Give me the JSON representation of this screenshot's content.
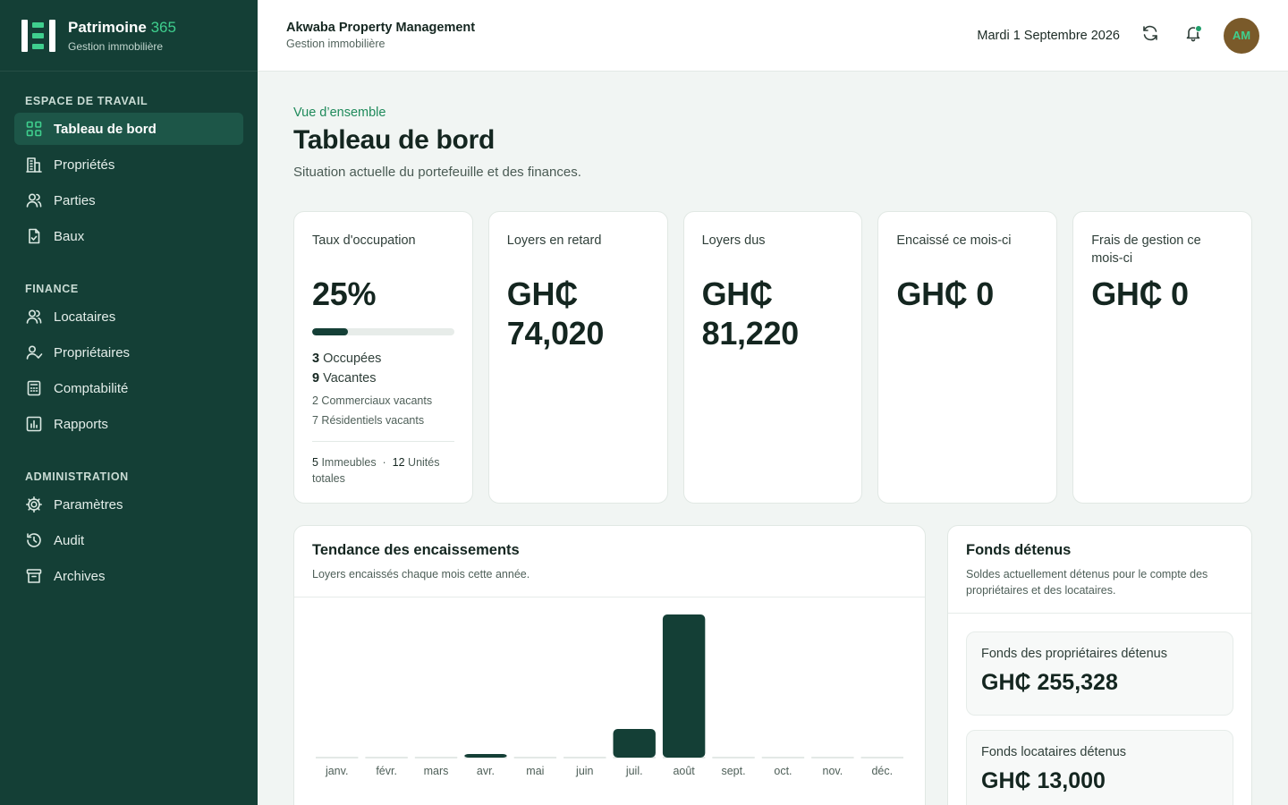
{
  "brand": {
    "name": "Patrimoine",
    "name_accent": "365",
    "subtitle": "Gestion immobilière"
  },
  "sidebar": {
    "sections": [
      {
        "title": "ESPACE DE TRAVAIL",
        "items": [
          {
            "label": "Tableau de bord",
            "icon": "grid-icon",
            "active": true
          },
          {
            "label": "Propriétés",
            "icon": "building-icon"
          },
          {
            "label": "Parties",
            "icon": "users-icon"
          },
          {
            "label": "Baux",
            "icon": "document-icon"
          }
        ]
      },
      {
        "title": "FINANCE",
        "items": [
          {
            "label": "Locataires",
            "icon": "users-icon"
          },
          {
            "label": "Propriétaires",
            "icon": "user-check-icon"
          },
          {
            "label": "Comptabilité",
            "icon": "calculator-icon"
          },
          {
            "label": "Rapports",
            "icon": "bar-chart-icon"
          }
        ]
      },
      {
        "title": "ADMINISTRATION",
        "items": [
          {
            "label": "Paramètres",
            "icon": "gear-icon"
          },
          {
            "label": "Audit",
            "icon": "history-icon"
          },
          {
            "label": "Archives",
            "icon": "archive-icon"
          }
        ]
      }
    ]
  },
  "topbar": {
    "org_name": "Akwaba Property Management",
    "org_sub": "Gestion immobilière",
    "date": "Mardi 1 Septembre 2026",
    "avatar_initials": "AM"
  },
  "page": {
    "eyebrow": "Vue d’ensemble",
    "title": "Tableau de bord",
    "subtitle": "Situation actuelle du portefeuille et des finances."
  },
  "kpis": {
    "occupancy": {
      "label": "Taux d'occupation",
      "value": "25%",
      "progress_fraction": 0.25,
      "occupied_count": "3",
      "occupied_label": "Occupées",
      "vacant_count": "9",
      "vacant_label": "Vacantes",
      "commercial_vacant": "2 Commerciaux vacants",
      "residential_vacant": "7 Résidentiels vacants",
      "buildings_count": "5",
      "buildings_label": "Immeubles",
      "separator": "·",
      "units_count": "12",
      "units_label": "Unités totales"
    },
    "late_rent": {
      "label": "Loyers en retard",
      "value_line1": "GH₵",
      "value_line2": "74,020"
    },
    "rent_due": {
      "label": "Loyers dus",
      "value_line1": "GH₵",
      "value_line2": "81,220"
    },
    "collected": {
      "label": "Encaissé ce mois-ci",
      "value": "GH₵ 0"
    },
    "fees": {
      "label": "Frais de gestion ce mois-ci",
      "value": "GH₵ 0"
    }
  },
  "trend": {
    "title": "Tendance des encaissements",
    "subtitle": "Loyers encaissés chaque mois cette année."
  },
  "chart_data": {
    "type": "bar",
    "categories": [
      "janv.",
      "févr.",
      "mars",
      "avr.",
      "mai",
      "juin",
      "juil.",
      "août",
      "sept.",
      "oct.",
      "nov.",
      "déc."
    ],
    "values": [
      0,
      0,
      0,
      2.5,
      0,
      0,
      20,
      100,
      0,
      0,
      0,
      0
    ],
    "ylim": [
      0,
      100
    ],
    "title": "Tendance des encaissements",
    "xlabel": "",
    "ylabel": "",
    "grid": false,
    "bar_color": "#143f36",
    "baseline_color": "#e3e9e6"
  },
  "funds": {
    "title": "Fonds détenus",
    "subtitle": "Soldes actuellement détenus pour le compte des propriétaires et des locataires.",
    "owners": {
      "label": "Fonds des propriétaires détenus",
      "value": "GH₵ 255,328"
    },
    "tenants": {
      "label": "Fonds locataires détenus",
      "value": "GH₵ 13,000"
    }
  },
  "colors": {
    "sidebar_bg": "#143f36",
    "accent": "#3fcf8e",
    "active_item_bg": "#1d5648"
  }
}
